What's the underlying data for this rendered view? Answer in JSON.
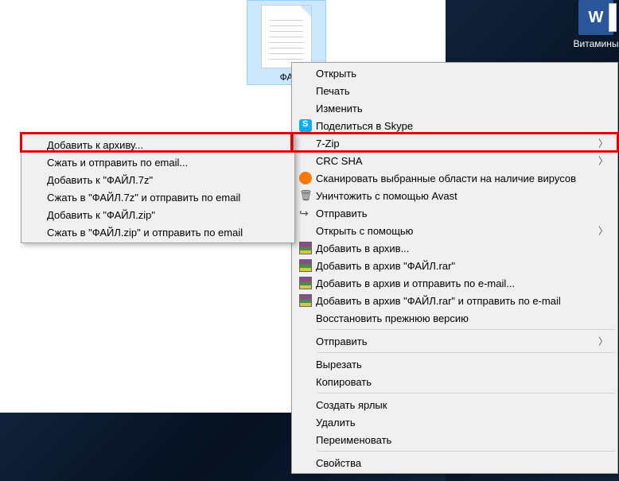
{
  "desktop": {
    "selected_file_label": "ФА",
    "word_file_label": "Витамины",
    "word_letter": "W"
  },
  "primary_menu": {
    "open": "Открыть",
    "print": "Печать",
    "edit": "Изменить",
    "skype": "Поделиться в Skype",
    "sevenzip": "7-Zip",
    "crc": "CRC SHA",
    "scan": "Сканировать выбранные области на наличие вирусов",
    "avast_delete": "Уничтожить с помощью Avast",
    "send": "Отправить",
    "open_with": "Открыть с помощью",
    "rar_add": "Добавить в архив...",
    "rar_add_named": "Добавить в архив \"ФАЙЛ.rar\"",
    "rar_email": "Добавить в архив и отправить по e-mail...",
    "rar_email_named": "Добавить в архив \"ФАЙЛ.rar\" и отправить по e-mail",
    "restore": "Восстановить прежнюю версию",
    "send_to": "Отправить",
    "cut": "Вырезать",
    "copy": "Копировать",
    "shortcut": "Создать ярлык",
    "delete": "Удалить",
    "rename": "Переименовать",
    "properties": "Свойства"
  },
  "submenu": {
    "add_archive": "Добавить к архиву...",
    "compress_email": "Сжать и отправить по email...",
    "add_7z": "Добавить к \"ФАЙЛ.7z\"",
    "compress_7z_email": "Сжать в \"ФАЙЛ.7z\" и отправить по email",
    "add_zip": "Добавить к \"ФАЙЛ.zip\"",
    "compress_zip_email": "Сжать в \"ФАЙЛ.zip\" и отправить по email"
  }
}
